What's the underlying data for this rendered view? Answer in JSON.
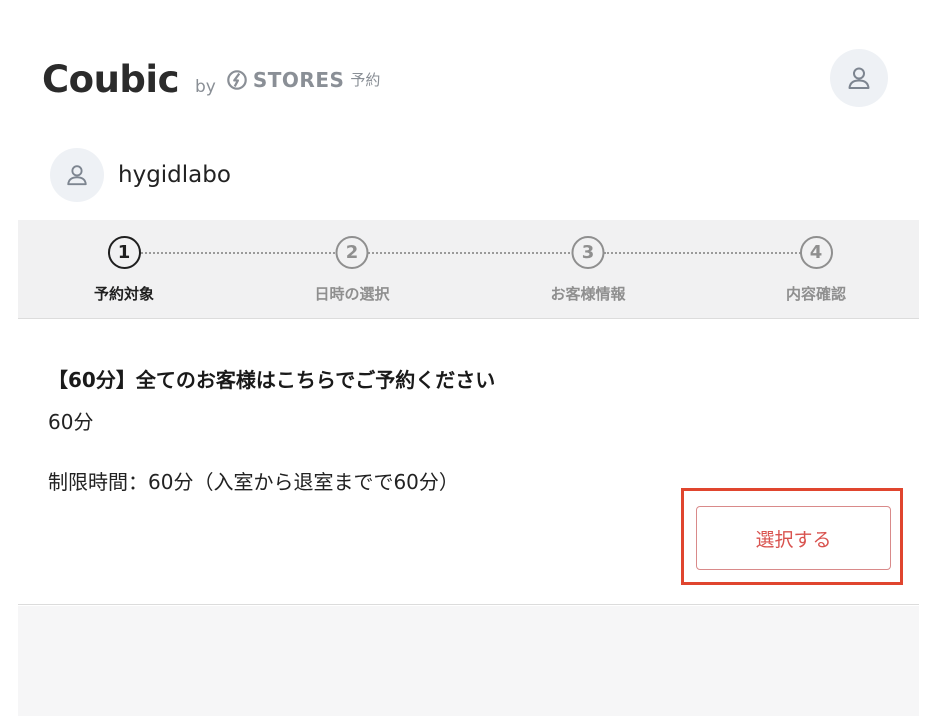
{
  "header": {
    "logo_main": "Coubic",
    "logo_by": "by",
    "stores_text": "STORES",
    "stores_suffix": "予約"
  },
  "shop": {
    "name": "hygidlabo"
  },
  "steps": [
    {
      "number": "1",
      "label": "予約対象",
      "active": true
    },
    {
      "number": "2",
      "label": "日時の選択",
      "active": false
    },
    {
      "number": "3",
      "label": "お客様情報",
      "active": false
    },
    {
      "number": "4",
      "label": "内容確認",
      "active": false
    }
  ],
  "menu": {
    "title": "【60分】全てのお客様はこちらでご予約ください",
    "duration": "60分",
    "limit": "制限時間：60分（入室から退室までで60分）",
    "select_label": "選択する"
  },
  "colors": {
    "accent": "#d9534f",
    "highlight": "#e0452e",
    "step_active": "#1f1f1f",
    "step_inactive": "#8f8f8f"
  },
  "icons": {
    "account": "user-icon",
    "shop_avatar": "user-icon",
    "stores_mark": "stores-logo-icon"
  }
}
